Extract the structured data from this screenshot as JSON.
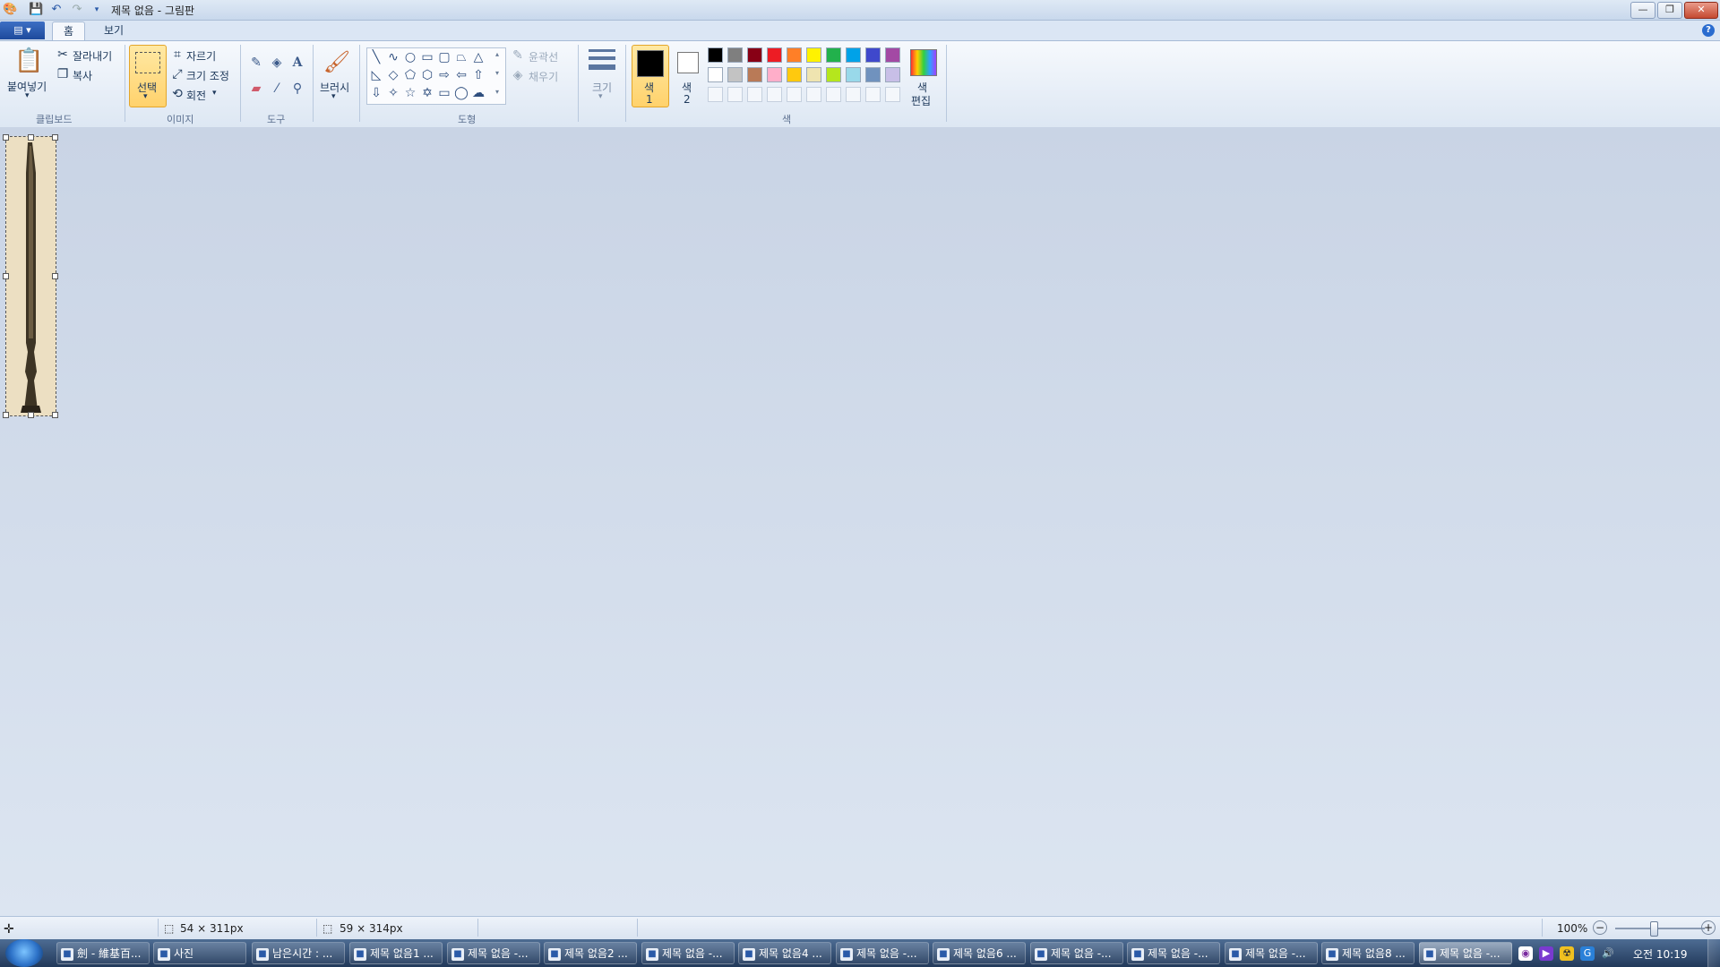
{
  "window": {
    "title": "제목 없음 - 그림판",
    "qa_save_icon": "save-icon",
    "qa_undo_icon": "undo-icon",
    "qa_redo_icon": "redo-icon",
    "minimize": "—",
    "restore": "❐",
    "close": "✕"
  },
  "tabs": [
    {
      "label": "홈"
    },
    {
      "label": "보기"
    }
  ],
  "appmenu": {
    "label": "▤ ▾"
  },
  "help": {
    "label": "?"
  },
  "ribbon": {
    "clipboard": {
      "paste_label": "붙여넣기",
      "cut_label": "잘라내기",
      "copy_label": "복사",
      "group_label": "클립보드"
    },
    "image": {
      "select_label": "선택",
      "crop_label": "자르기",
      "resize_label": "크기 조정",
      "rotate_label": "회전",
      "group_label": "이미지"
    },
    "tools": {
      "group_label": "도구",
      "items": [
        "pencil-icon",
        "fill-icon",
        "text-icon",
        "eraser-icon",
        "color-picker-icon",
        "magnifier-icon"
      ]
    },
    "brushes": {
      "label": "브러시"
    },
    "shapes": {
      "outline_label": "윤곽선",
      "fill_label": "채우기",
      "group_label": "도형"
    },
    "size": {
      "label": "크기"
    },
    "colors": {
      "color1_label_a": "색",
      "color1_label_b": "1",
      "color2_label_a": "색",
      "color2_label_b": "2",
      "edit_label_a": "색",
      "edit_label_b": "편집",
      "group_label": "색",
      "color1": "#000000",
      "color2": "#ffffff",
      "palette_row1": [
        "#000000",
        "#7f7f7f",
        "#880015",
        "#ed1c24",
        "#ff7f27",
        "#fff200",
        "#22b14c",
        "#00a2e8",
        "#3f48cc",
        "#a349a4"
      ],
      "palette_row2": [
        "#ffffff",
        "#c3c3c3",
        "#b97a57",
        "#ffaec9",
        "#ffc90e",
        "#efe4b0",
        "#b5e61d",
        "#99d9ea",
        "#7092be",
        "#c8bfe7"
      ]
    }
  },
  "status": {
    "selection_size": "54 × 311px",
    "canvas_size": "59 × 314px",
    "zoom": "100%"
  },
  "taskbar": {
    "items": [
      {
        "label": "劍 - 維基百...",
        "icon": "ie-icon"
      },
      {
        "label": "사진",
        "icon": "photo-icon"
      },
      {
        "label": "남은시간 : ...",
        "icon": "timer-icon"
      },
      {
        "label": "제목 없음1 ...",
        "icon": "paint-icon"
      },
      {
        "label": "제목 없음 -...",
        "icon": "paint-icon"
      },
      {
        "label": "제목 없음2 ...",
        "icon": "paint-icon"
      },
      {
        "label": "제목 없음 -...",
        "icon": "paint-icon"
      },
      {
        "label": "제목 없음4 ...",
        "icon": "paint-icon"
      },
      {
        "label": "제목 없음 -...",
        "icon": "paint-icon"
      },
      {
        "label": "제목 없음6 ...",
        "icon": "paint-icon"
      },
      {
        "label": "제목 없음 -...",
        "icon": "paint-icon"
      },
      {
        "label": "제목 없음 -...",
        "icon": "paint-icon"
      },
      {
        "label": "제목 없음 -...",
        "icon": "paint-icon"
      },
      {
        "label": "제목 없음8 ...",
        "icon": "paint-icon"
      },
      {
        "label": "제목 없음 -...",
        "icon": "paint-icon"
      }
    ],
    "clock": "오전 10:19"
  }
}
